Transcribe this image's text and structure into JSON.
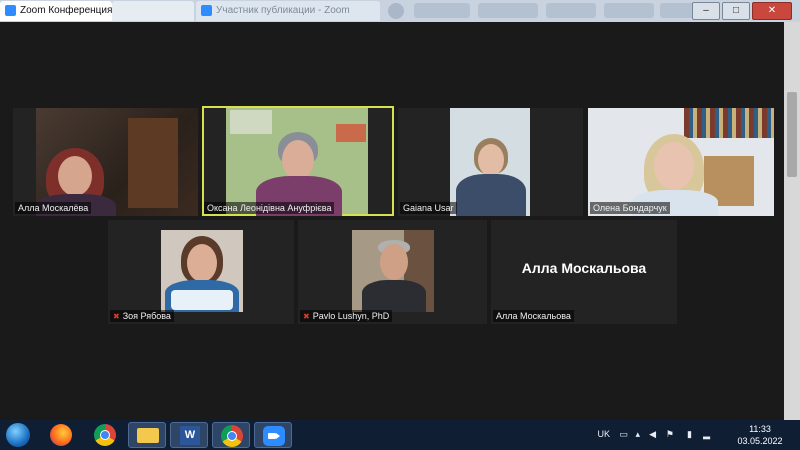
{
  "window": {
    "tab_title": "Zoom Конференция",
    "tab2_title": "Участник публикации - Zoom",
    "minimize": "–",
    "maximize": "□",
    "close": "✕"
  },
  "participants": [
    {
      "name": "Алла Москалёва",
      "muted": false
    },
    {
      "name": "Оксана Леонідівна Ануфрієва",
      "muted": false,
      "speaking": true
    },
    {
      "name": "Gaiana Usar",
      "muted": false
    },
    {
      "name": "Олена Бондарчук",
      "muted": false
    },
    {
      "name": "Зоя Рябова",
      "muted": true
    },
    {
      "name": "Pavlo Lushyn, PhD",
      "muted": true
    },
    {
      "name": "Алла Москальова",
      "muted": false,
      "video_off": true
    }
  ],
  "taskbar": {
    "apps": [
      "firefox-icon",
      "chrome-icon",
      "explorer-icon",
      "word-icon",
      "chrome-icon",
      "zoom-icon"
    ]
  },
  "tray": {
    "language": "UK",
    "time": "11:33",
    "date": "03.05.2022"
  },
  "colors": {
    "active_speaker_border": "#d8e04d",
    "zoom_background": "#1a1a1a",
    "taskbar": "#0f1e33",
    "muted_icon": "#e0392b"
  }
}
